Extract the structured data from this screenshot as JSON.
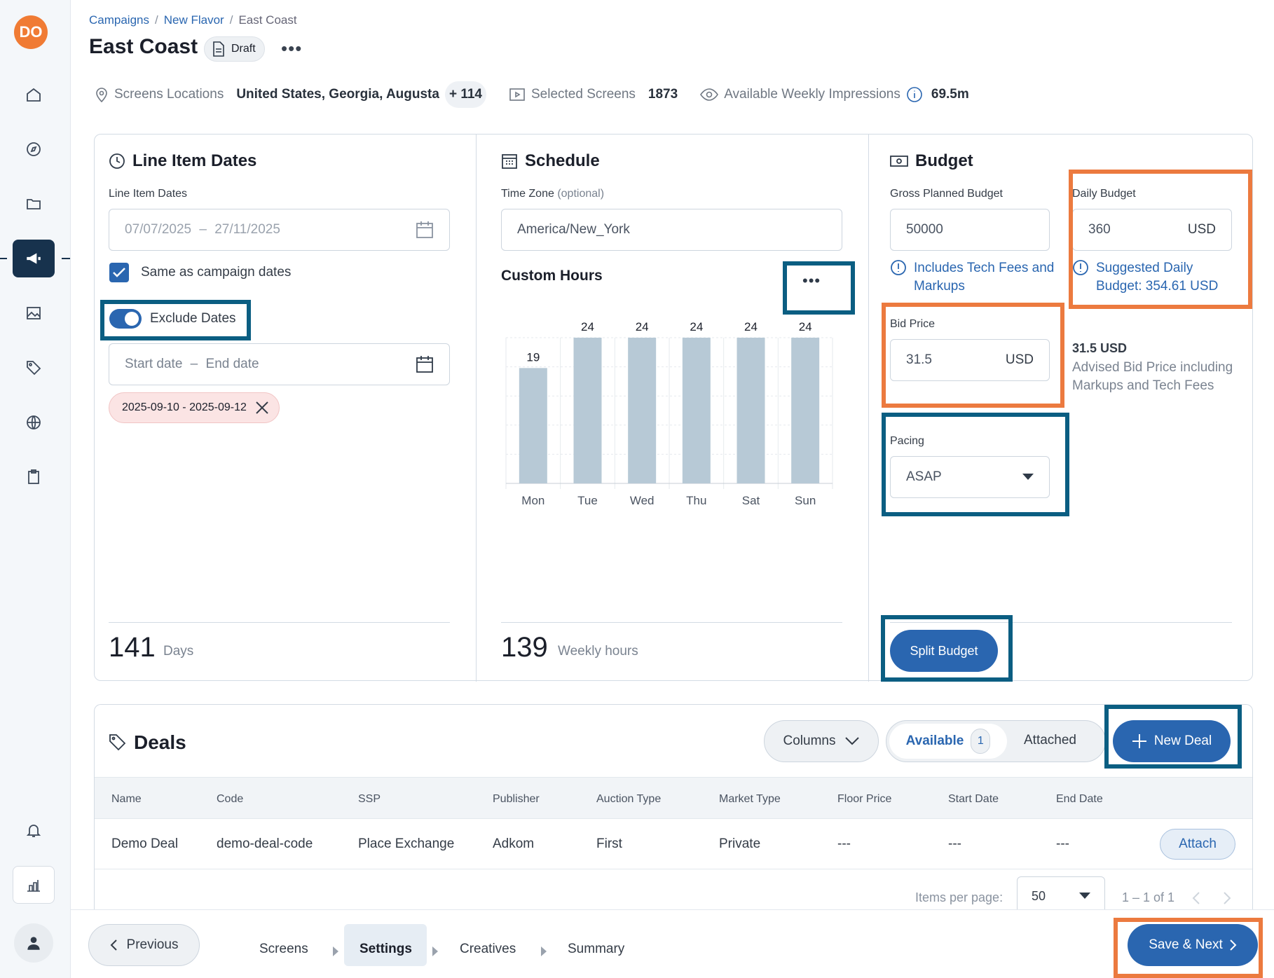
{
  "sidebar": {
    "logo": "DO",
    "items": [
      "home-icon",
      "compass-icon",
      "folder-icon",
      "megaphone-icon",
      "image-icon",
      "tag-icon",
      "globe-icon",
      "clipboard-icon"
    ],
    "bottom": [
      "bell-icon",
      "building-chart-icon",
      "user-icon"
    ]
  },
  "breadcrumb": {
    "items": [
      "Campaigns",
      "New Flavor",
      "East Coast"
    ],
    "sep": "/"
  },
  "page": {
    "title": "East Coast",
    "status": "Draft",
    "more": "•••"
  },
  "summary": {
    "locations_label": "Screens Locations",
    "locations_value": "United States, Georgia, Augusta",
    "locations_more": "+ 114",
    "screens_label": "Selected Screens",
    "screens_value": "1873",
    "impressions_label": "Available Weekly Impressions",
    "impressions_value": "69.5m"
  },
  "dates": {
    "title": "Line Item Dates",
    "field_label": "Line Item Dates",
    "start": "07/07/2025",
    "end": "27/11/2025",
    "dash": "–",
    "same_label": "Same as campaign dates",
    "exclude_label": "Exclude Dates",
    "start_placeholder": "Start date",
    "end_placeholder": "End date",
    "excluded": "2025-09-10 - 2025-09-12",
    "total": "141",
    "total_unit": "Days"
  },
  "schedule": {
    "title": "Schedule",
    "tz_label": "Time Zone",
    "tz_optional": "(optional)",
    "tz_value": "America/New_York",
    "custom_label": "Custom Hours",
    "more": "•••",
    "total": "139",
    "total_unit": "Weekly hours"
  },
  "chart_data": {
    "type": "bar",
    "categories": [
      "Mon",
      "Tue",
      "Wed",
      "Thu",
      "Sat",
      "Sun"
    ],
    "values": [
      19,
      24,
      24,
      24,
      24,
      24
    ],
    "ylim": [
      0,
      24
    ],
    "grid": true,
    "color": "#b7c9d6"
  },
  "budget": {
    "title": "Budget",
    "gross_label": "Gross Planned Budget",
    "gross_value": "50000",
    "includes": "Includes Tech Fees and Markups",
    "daily_label": "Daily Budget",
    "daily_value": "360",
    "daily_unit": "USD",
    "suggested": "Suggested Daily Budget: 354.61 USD",
    "bid_label": "Bid Price",
    "bid_value": "31.5",
    "bid_unit": "USD",
    "advised_value": "31.5 USD",
    "advised_text": "Advised Bid Price including Markups and Tech Fees",
    "pacing_label": "Pacing",
    "pacing_value": "ASAP",
    "split": "Split Budget"
  },
  "deals": {
    "title": "Deals",
    "columns_btn": "Columns",
    "tab_available": "Available",
    "tab_count": "1",
    "tab_attached": "Attached",
    "new_deal": "New Deal",
    "headers": [
      "Name",
      "Code",
      "SSP",
      "Publisher",
      "Auction Type",
      "Market Type",
      "Floor Price",
      "Start Date",
      "End Date"
    ],
    "rows": [
      [
        "Demo Deal",
        "demo-deal-code",
        "Place Exchange",
        "Adkom",
        "First",
        "Private",
        "---",
        "---",
        "---"
      ]
    ],
    "attach": "Attach",
    "per_page_label": "Items per page:",
    "per_page": "50",
    "range": "1 – 1 of 1"
  },
  "footer": {
    "previous": "Previous",
    "steps": [
      "Screens",
      "Settings",
      "Creatives",
      "Summary"
    ],
    "active_step": "Settings",
    "save": "Save & Next"
  },
  "colors": {
    "accent": "#2a66b0",
    "highlight_blue": "#0b5e82",
    "highlight_orange": "#ec7a3f",
    "logo": "#f07b34"
  }
}
